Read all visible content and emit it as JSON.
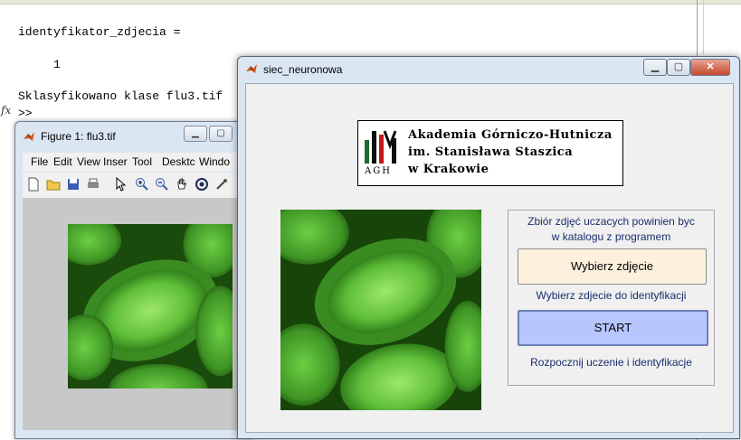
{
  "command_window": {
    "line1": "identyfikator_zdjecia =",
    "line2": "     1",
    "line3": "Sklasyfikowano klase flu3.tif",
    "prompt": ">>",
    "fx": "fx"
  },
  "figure1": {
    "title": "Figure 1: flu3.tif",
    "menus": [
      "File",
      "Edit",
      "View",
      "Inser",
      "Tool",
      "Desktc",
      "Windo"
    ],
    "toolbar_icons": [
      "new-file-icon",
      "open-folder-icon",
      "save-icon",
      "print-icon",
      "pointer-icon",
      "zoom-in-icon",
      "zoom-out-icon",
      "pan-hand-icon",
      "rotate-3d-icon",
      "data-cursor-icon"
    ]
  },
  "nn_window": {
    "title": "siec_neuronowa",
    "logo": {
      "line1": "Akademia Górniczo-Hutnicza",
      "line2": "im. Stanisława Staszica",
      "line3": "w Krakowie",
      "abbr": "AGH"
    },
    "panel": {
      "info1": "Zbiór zdjęć uczacych powinien byc",
      "info2": "w katalogu z programem",
      "pick_button": "Wybierz zdjęcie",
      "pick_hint": "Wybierz zdjecie do identyfikacji",
      "start_button": "START",
      "start_hint": "Rozpocznij uczenie i identyfikacje"
    }
  },
  "colors": {
    "window_frame": "#dbe6f3",
    "pick_button": "#fdf0dc",
    "start_button": "#b7c6ff",
    "hint_text": "#1a2e6e",
    "image_green": "#2f8a1f"
  }
}
